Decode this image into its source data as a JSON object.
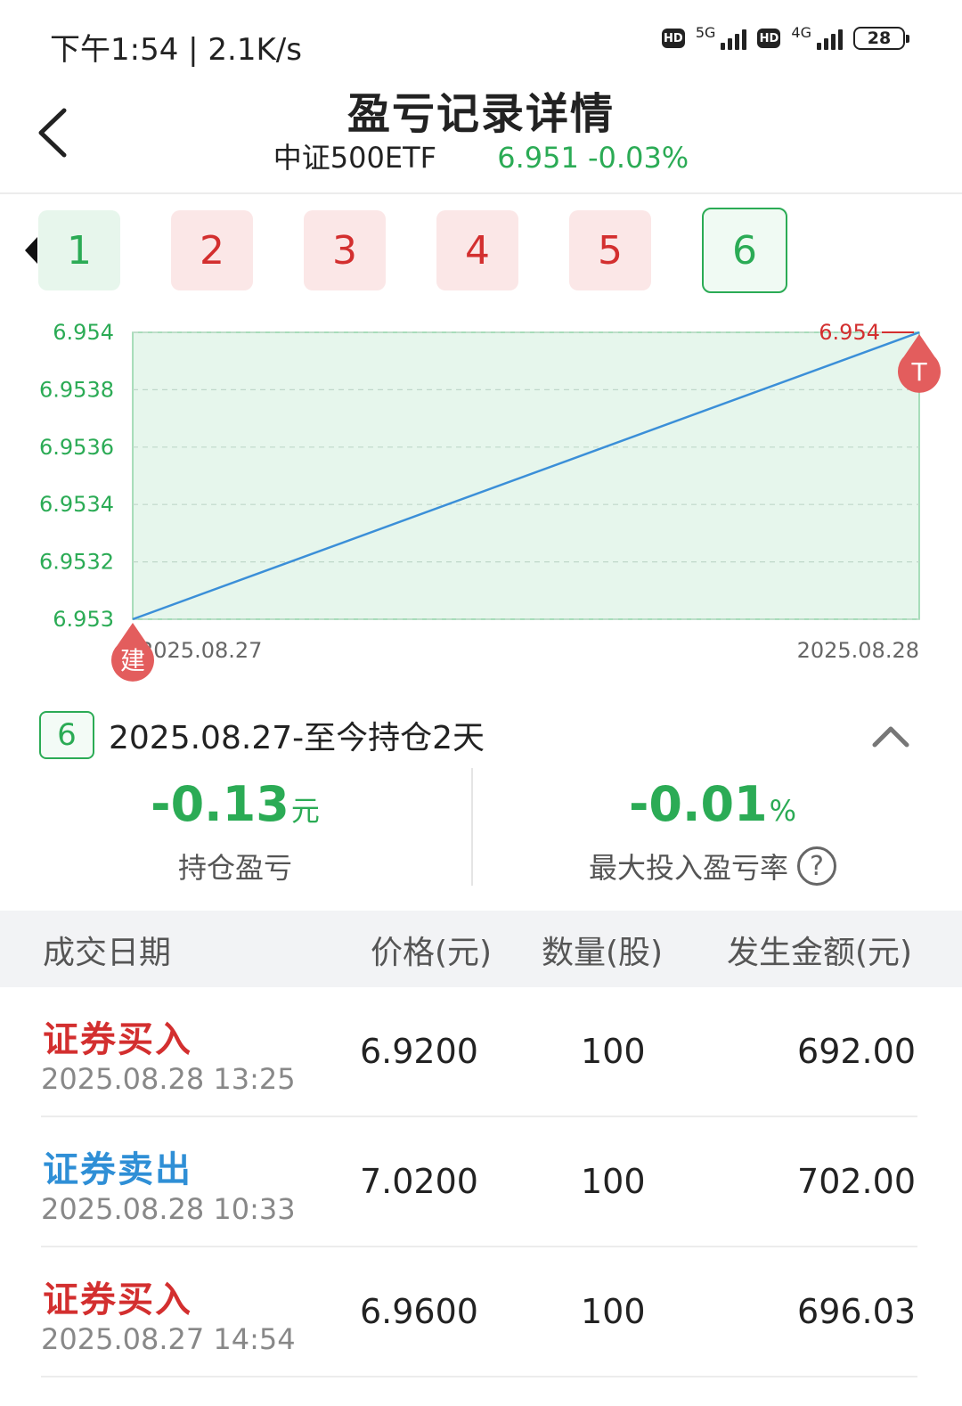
{
  "status_bar": {
    "time": "下午1:54 | 2.1K/s",
    "hd1": "HD",
    "net1": "5G",
    "hd2": "HD",
    "net2": "4G",
    "battery": "28"
  },
  "header": {
    "title": "盈亏记录详情",
    "stock_name": "中证500ETF",
    "quote": "6.951 -0.03%"
  },
  "record_tabs": [
    {
      "label": "1",
      "color": "#2bab55"
    },
    {
      "label": "2",
      "color": "#d32f2f"
    },
    {
      "label": "3",
      "color": "#d32f2f"
    },
    {
      "label": "4",
      "color": "#d32f2f"
    },
    {
      "label": "5",
      "color": "#d32f2f"
    },
    {
      "label": "6",
      "color": "#2bab55",
      "selected": true
    }
  ],
  "chart_data": {
    "type": "area",
    "x": [
      "2025.08.27",
      "2025.08.28"
    ],
    "series": [
      {
        "values": [
          6.953,
          6.954
        ]
      }
    ],
    "ylim": [
      6.953,
      6.954
    ],
    "yticks": [
      "6.954",
      "6.9538",
      "6.9536",
      "6.9534",
      "6.9532",
      "6.953"
    ],
    "ytick_values": [
      6.954,
      6.9538,
      6.9536,
      6.9534,
      6.9532,
      6.953
    ],
    "end_label": "6.954",
    "start_marker": "建",
    "end_marker": "T",
    "grid": true,
    "line_color": "#3b8fd8",
    "fill_color": "#e6f6ec"
  },
  "holding": {
    "badge": "6",
    "period": "2025.08.27-至今持仓2天",
    "pnl_value": "-0.13",
    "pnl_unit": "元",
    "pnl_label": "持仓盈亏",
    "rate_value": "-0.01",
    "rate_unit": "%",
    "rate_label": "最大投入盈亏率",
    "help": "?"
  },
  "table": {
    "headers": {
      "date": "成交日期",
      "price": "价格(元)",
      "qty": "数量(股)",
      "amount": "发生金额(元)"
    },
    "rows": [
      {
        "type": "证券买入",
        "time": "2025.08.28 13:25",
        "price": "6.9200",
        "qty": "100",
        "amount": "692.00"
      },
      {
        "type": "证券卖出",
        "time": "2025.08.28 10:33",
        "price": "7.0200",
        "qty": "100",
        "amount": "702.00"
      },
      {
        "type": "证券买入",
        "time": "2025.08.27 14:54",
        "price": "6.9600",
        "qty": "100",
        "amount": "696.03"
      }
    ]
  },
  "colors": {
    "up": "#d32f2f",
    "down": "#2bab55",
    "sell": "#2f8fd6"
  }
}
